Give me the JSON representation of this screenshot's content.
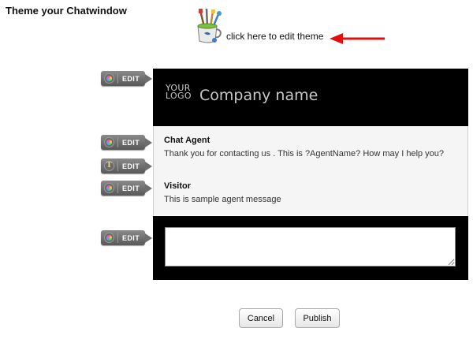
{
  "page": {
    "title": "Theme your Chatwindow"
  },
  "theme_link": {
    "label": "click here to edit theme",
    "icon": "paint-cup-icon"
  },
  "arrow": {
    "color": "#e01010"
  },
  "preview": {
    "header": {
      "logo_line1": "YOUR",
      "logo_line2": "LOGO",
      "company_name": "Company name",
      "background": "#000000"
    },
    "agent": {
      "name": "Chat Agent",
      "message": "Thank you for contacting us . This is ?AgentName? How may I help you?"
    },
    "visitor": {
      "name": "Visitor",
      "message": "This is sample agent message"
    },
    "input": {
      "value": "",
      "placeholder": ""
    }
  },
  "edit_tags": {
    "header": {
      "label": "EDIT",
      "icon": "color-wheel-icon"
    },
    "agent": {
      "label": "EDIT",
      "icon": "color-wheel-icon"
    },
    "font": {
      "label": "EDIT",
      "icon": "font-icon",
      "glyph": "T"
    },
    "visitor": {
      "label": "EDIT",
      "icon": "color-wheel-icon"
    },
    "footer": {
      "label": "EDIT",
      "icon": "color-wheel-icon"
    }
  },
  "buttons": {
    "cancel": "Cancel",
    "publish": "Publish"
  }
}
